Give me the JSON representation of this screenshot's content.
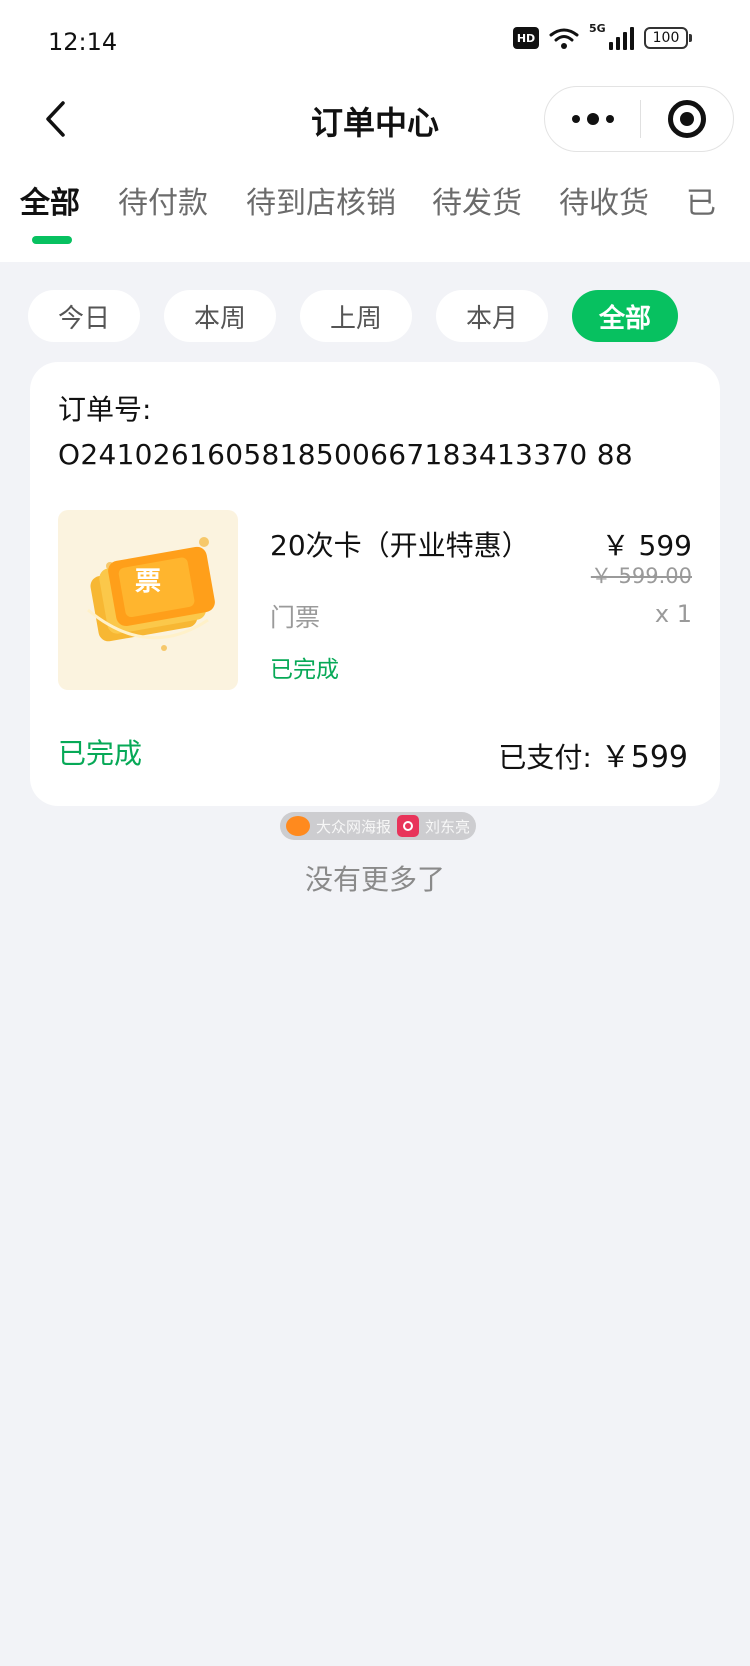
{
  "status_bar": {
    "time": "12:14",
    "hd_label": "HD",
    "network_label": "5G",
    "battery_level": "100"
  },
  "nav": {
    "title": "订单中心"
  },
  "tabs": [
    {
      "label": "全部",
      "active": true
    },
    {
      "label": "待付款",
      "active": false
    },
    {
      "label": "待到店核销",
      "active": false
    },
    {
      "label": "待发货",
      "active": false
    },
    {
      "label": "待收货",
      "active": false
    },
    {
      "label": "已",
      "active": false
    }
  ],
  "filters": [
    {
      "label": "今日",
      "active": false
    },
    {
      "label": "本周",
      "active": false
    },
    {
      "label": "上周",
      "active": false
    },
    {
      "label": "本月",
      "active": false
    },
    {
      "label": "全部",
      "active": true
    }
  ],
  "order": {
    "order_no_label": "订单号:",
    "order_no": "O2410261605818500667183413370 88",
    "product": {
      "image_text": "票",
      "name": "20次卡（开业特惠）",
      "price": "￥ 599",
      "original_price": "￥ 599.00",
      "category": "门票",
      "quantity": "x 1",
      "status": "已完成"
    },
    "status": "已完成",
    "paid_label": "已支付:",
    "paid_amount": "￥599"
  },
  "watermark": {
    "text_left": "大众网海报",
    "text_right": "刘东亮"
  },
  "footer": {
    "no_more": "没有更多了"
  },
  "colors": {
    "accent": "#07c160",
    "success_text": "#07a957",
    "page_bg": "#f2f3f7"
  }
}
